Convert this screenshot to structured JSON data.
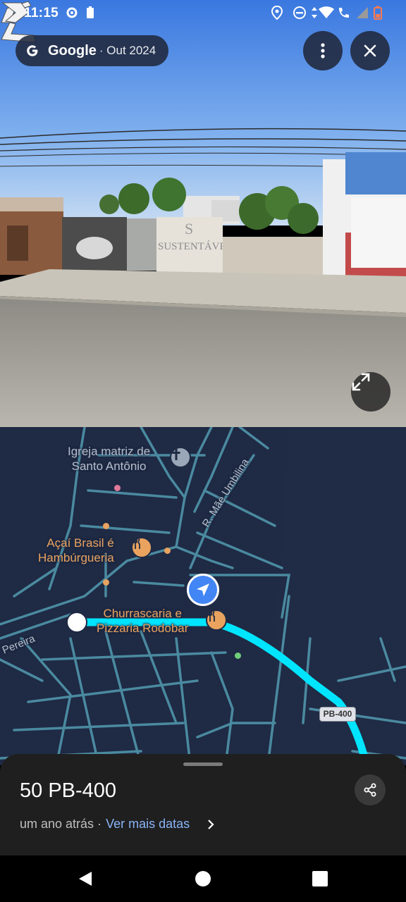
{
  "status_bar": {
    "time": "11:15",
    "icons": [
      "settings-icon",
      "battery-saver-icon",
      "location-icon",
      "do-not-disturb-icon",
      "data-arrows-icon",
      "wifi-icon",
      "wifi-calling-icon",
      "signal-icon",
      "battery-icon"
    ]
  },
  "street_view": {
    "brand": "Google",
    "date": "· Out 2024",
    "more_icon": "more-vert-icon",
    "close_icon": "close-icon",
    "fullscreen_icon": "expand-icon",
    "wall_text": "SUSTENTÁVEL",
    "sign_text": "S"
  },
  "map": {
    "labels": {
      "church": "Igreja matriz de\nSanto Antônio",
      "street_umbilina": "R. Mãe Umbilina",
      "acai": "Açaí Brasil é\nHambúrgueria",
      "churrascaria": "Churrascaria e\nPizzaria Rodobar",
      "pereira": "Pereira",
      "route_shield": "PB-400"
    },
    "colors": {
      "background": "#1f2a44",
      "road": "#4a8aa0",
      "route": "#00e5ff",
      "poi": "#e9a35f"
    }
  },
  "bottom_sheet": {
    "title": "50 PB-400",
    "subtitle": "um ano atrás ·",
    "more_dates": "Ver mais datas",
    "share_icon": "share-icon"
  },
  "nav_bar": {
    "back_icon": "back-icon",
    "home_icon": "home-icon",
    "recents_icon": "recents-icon"
  }
}
